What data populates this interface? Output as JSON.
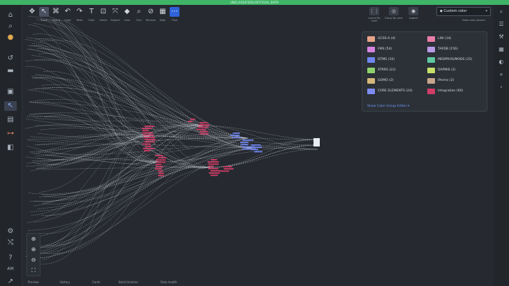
{
  "banner": {
    "text": "UNCLASSIFIED//OFFICIAL DATA"
  },
  "toolbar": {
    "tools": [
      {
        "icon": "move-icon",
        "glyph": "✥",
        "label": ""
      },
      {
        "icon": "pointer-icon",
        "glyph": "↖",
        "label": "Touch"
      },
      {
        "icon": "layout-icon",
        "glyph": "⌘",
        "label": "Layout"
      },
      {
        "icon": "undo-icon",
        "glyph": "↶",
        "label": "Undo"
      },
      {
        "icon": "redo-icon",
        "glyph": "↷",
        "label": "Redo"
      },
      {
        "icon": "clear-icon",
        "glyph": "T",
        "label": "Clear"
      },
      {
        "icon": "select-icon",
        "glyph": "⊡",
        "label": "Select"
      },
      {
        "icon": "expand-icon",
        "glyph": "⤧",
        "label": "Expand"
      },
      {
        "icon": "color-icon",
        "glyph": "◆",
        "label": "Color"
      },
      {
        "icon": "find-icon",
        "glyph": "⌕",
        "label": "Find"
      },
      {
        "icon": "remove-icon",
        "glyph": "⊘",
        "label": "Remove"
      },
      {
        "icon": "align-icon",
        "glyph": "▦",
        "label": "Align"
      },
      {
        "icon": "flow-icon",
        "glyph": "⋯",
        "label": "Flow"
      }
    ]
  },
  "right_tools": {
    "layout": {
      "label": "Layout By color",
      "glyph": "⋮⋮"
    },
    "group": {
      "label": "Group By color",
      "glyph": "◎"
    },
    "legend": {
      "label": "Legend",
      "glyph": "◉"
    },
    "color_select": {
      "value": "Custom color",
      "glyph": "◆"
    },
    "color_options": "Node color options"
  },
  "legend": {
    "items": [
      {
        "label": "GCSS-A (4)",
        "color": "#e8a488"
      },
      {
        "label": "LIW (14)",
        "color": "#e77fa6"
      },
      {
        "label": "FMS (54)",
        "color": "#d584e0"
      },
      {
        "label": "TAFDB (156)",
        "color": "#b99be6"
      },
      {
        "label": "DTMS (10)",
        "color": "#6f86f0"
      },
      {
        "label": "MEDPROS/MODS (25)",
        "color": "#5ec9a2"
      },
      {
        "label": "ATRRS (22)",
        "color": "#8fd26c"
      },
      {
        "label": "DAPMIS (2)",
        "color": "#c7e06a"
      },
      {
        "label": "GOMO (2)",
        "color": "#d6b77a"
      },
      {
        "label": "iPerms (2)",
        "color": "#c9a58e"
      },
      {
        "label": "CORE ELEMENTS (24)",
        "color": "#7d8cf0"
      },
      {
        "label": "Integration (60)",
        "color": "#d23d67"
      }
    ],
    "link": "Show Color Group Editor ▾"
  },
  "bottom": {
    "items": [
      "Preview",
      "History",
      "Cards",
      "Build timeline",
      "Data health"
    ]
  },
  "colors": {
    "edge": "#c9d0d8",
    "node_pink": "#d23d67",
    "node_blue": "#6f86f0",
    "accent": "#2f63d9"
  }
}
